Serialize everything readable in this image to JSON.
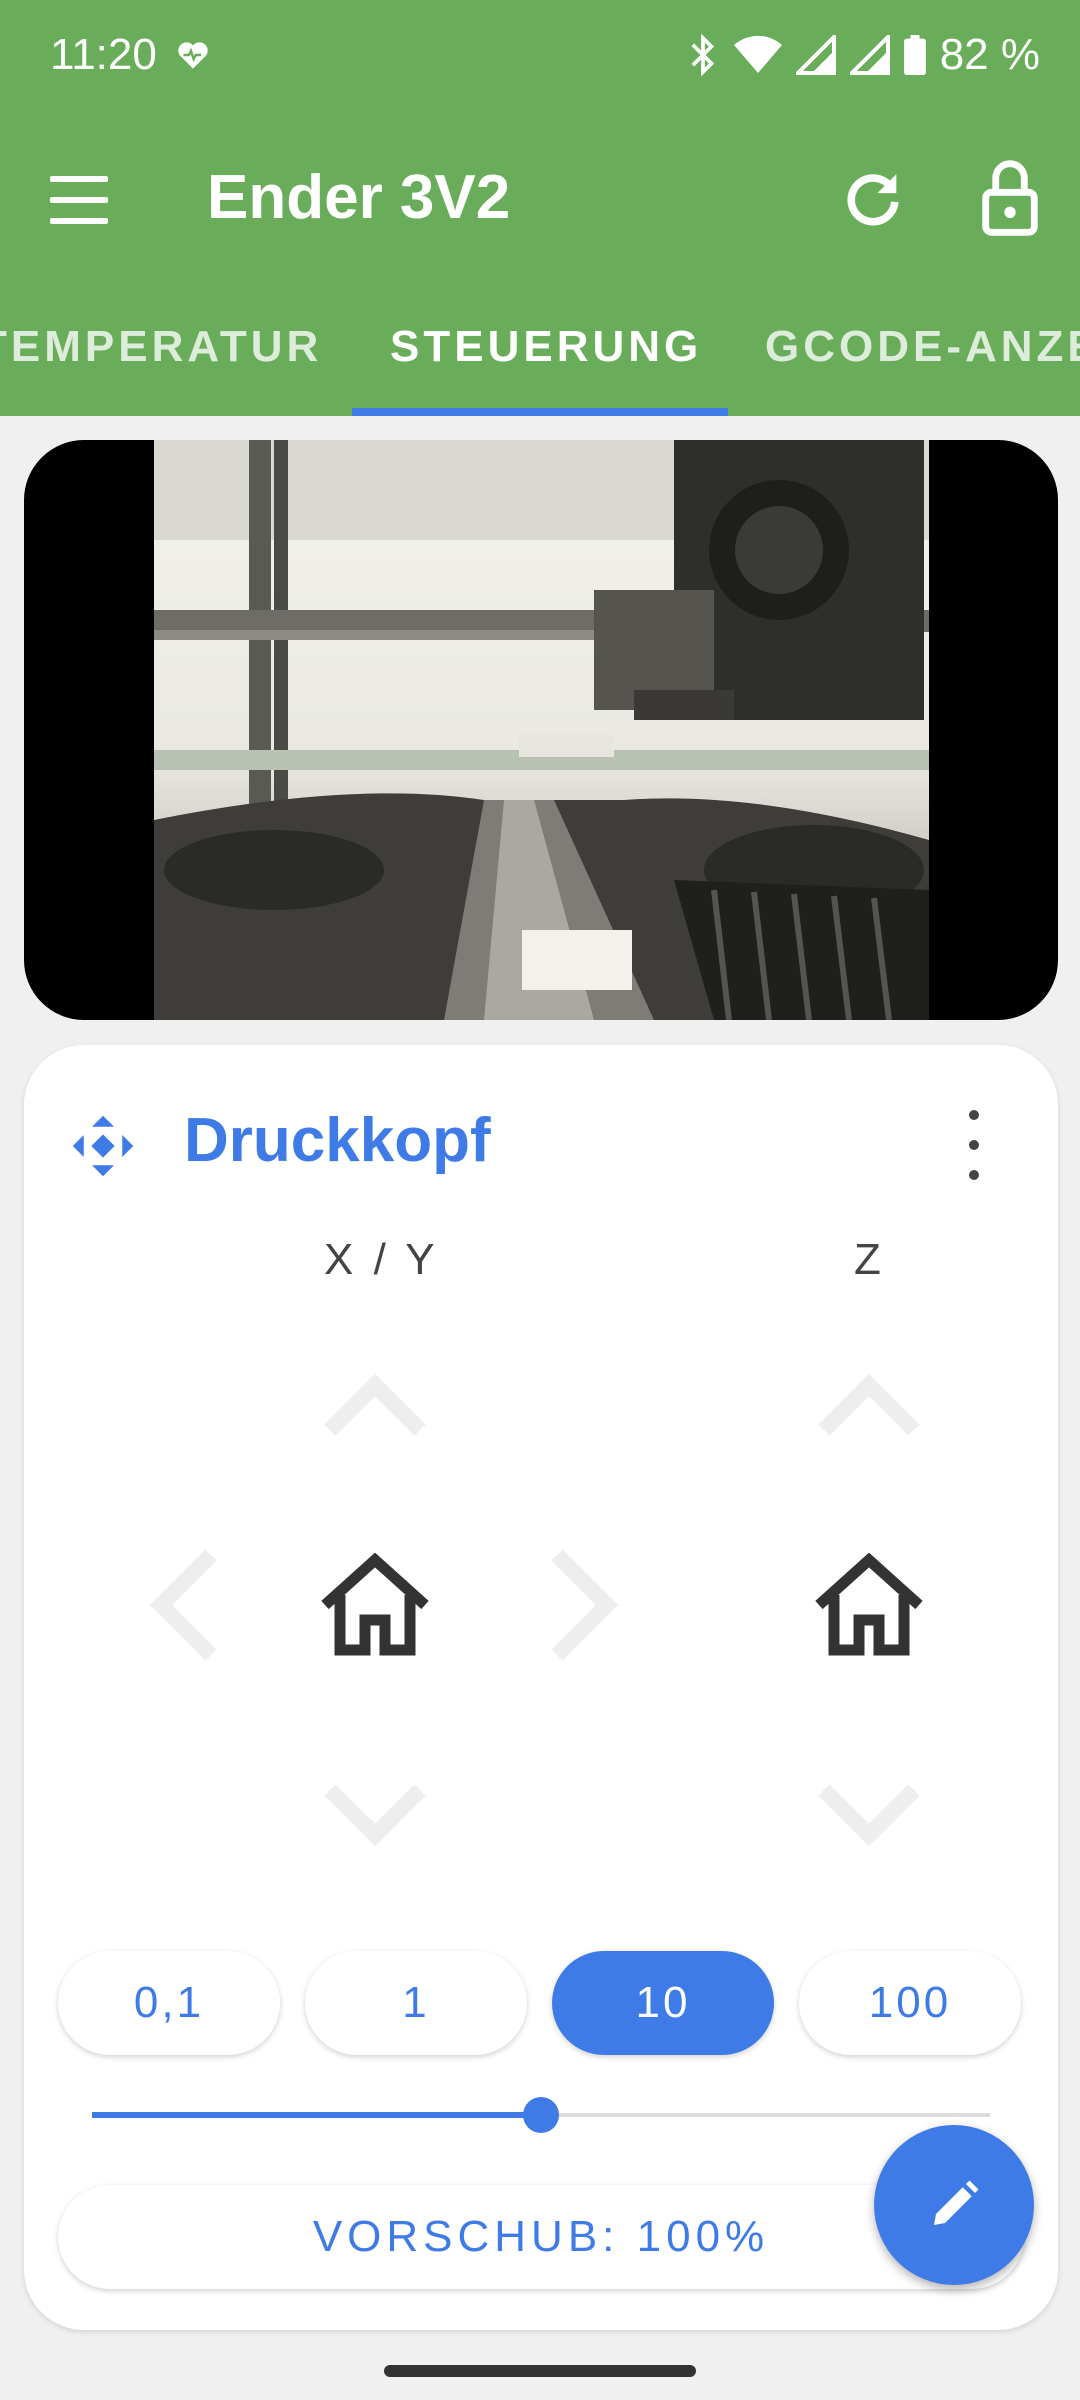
{
  "status_bar": {
    "time": "11:20",
    "battery": "82 %"
  },
  "app_bar": {
    "title": "Ender 3V2"
  },
  "tabs": [
    {
      "label": "TEMPERATUR"
    },
    {
      "label": "STEUERUNG"
    },
    {
      "label": "GCODE-ANZE"
    }
  ],
  "card": {
    "title": "Druckkopf",
    "axis_xy_label": "X / Y",
    "axis_z_label": "Z",
    "steps": [
      "0,1",
      "1",
      "10",
      "100"
    ],
    "active_step": "10",
    "feedrate_label": "VORSCHUB: 100%",
    "slider_fraction": 0.5
  },
  "colors": {
    "brand_green": "#69ad5a",
    "accent_blue": "#3f7be6"
  }
}
